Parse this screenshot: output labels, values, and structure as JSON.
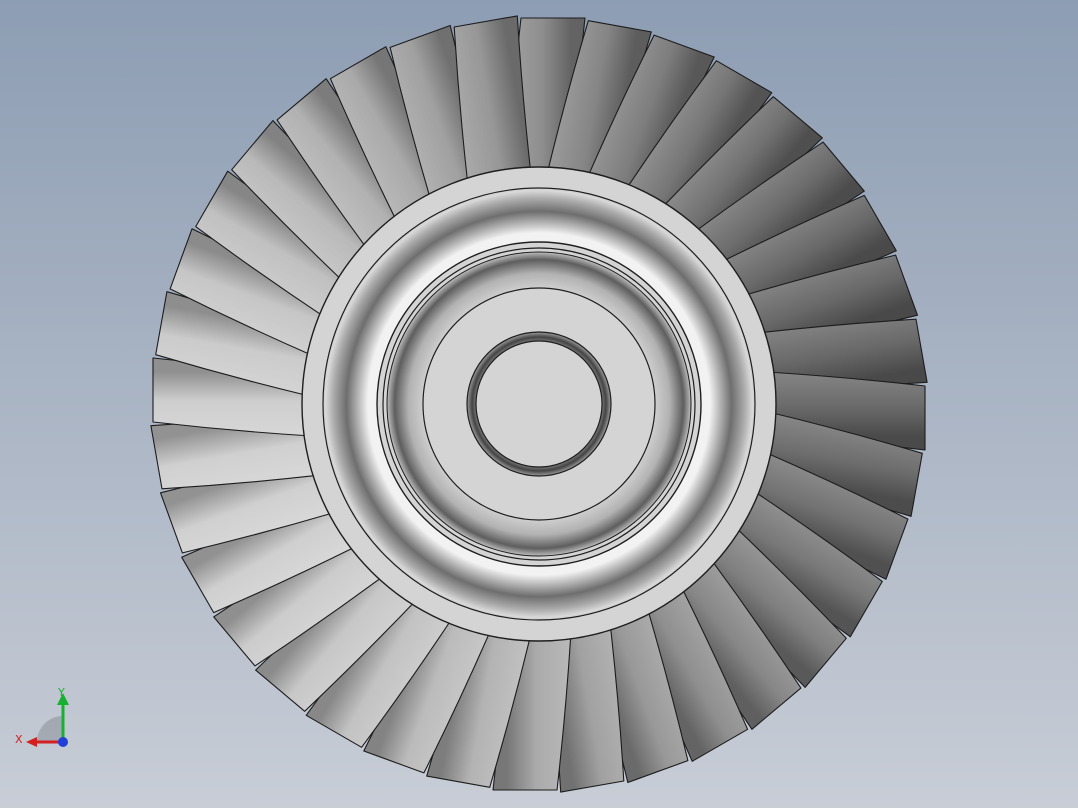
{
  "viewport": {
    "background_top": "#8d9db3",
    "background_bottom": "#c8cdd6",
    "model": {
      "type": "bladed-turbine-disk",
      "blade_count": 36,
      "blade_tone_dark": "#5a5a5a",
      "blade_tone_light": "#d2d2d2",
      "hub_color": "#d4d4d4",
      "edge_color": "#1c1c1c"
    }
  },
  "triad": {
    "x_label": "X",
    "y_label": "Y",
    "x_color": "#d42020",
    "y_color": "#18b030",
    "z_color": "#2040d8"
  }
}
